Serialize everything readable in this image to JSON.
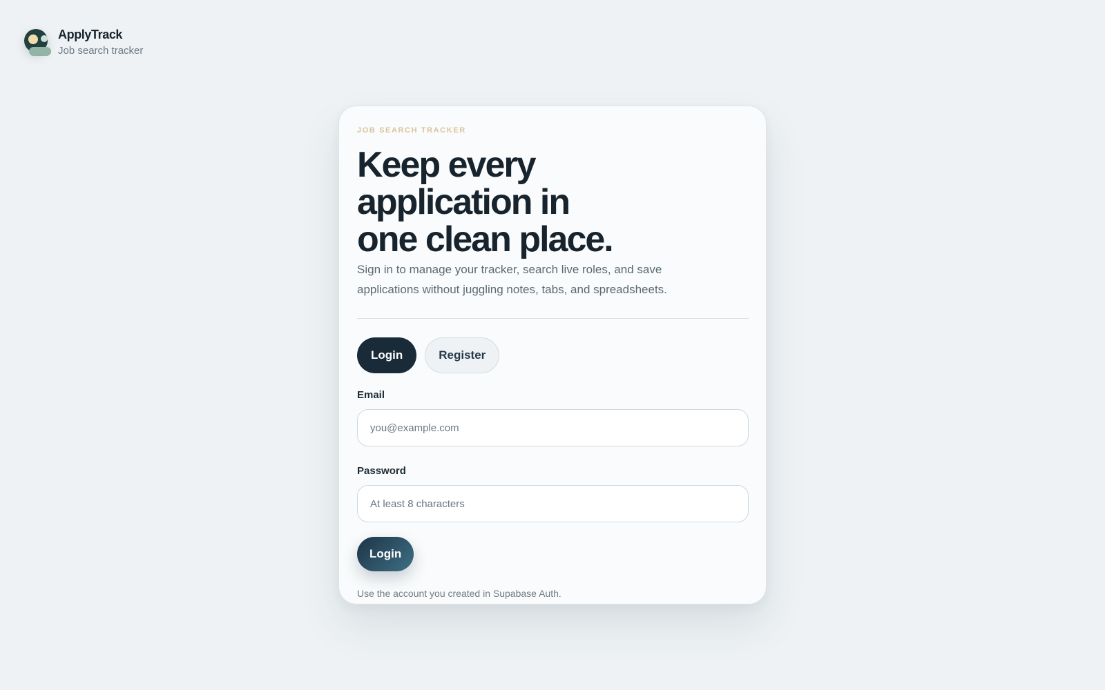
{
  "brand": {
    "name": "ApplyTrack",
    "tagline": "Job search tracker",
    "logo_icon": "avatar-logo-icon"
  },
  "card": {
    "eyebrow": "JOB SEARCH TRACKER",
    "headline": "Keep every application in one clean place.",
    "lede": "Sign in to manage your tracker, search live roles, and save applications without juggling notes, tabs, and spreadsheets.",
    "tabs": [
      {
        "label": "Login",
        "active": true
      },
      {
        "label": "Register",
        "active": false
      }
    ],
    "email": {
      "label": "Email",
      "placeholder": "you@example.com",
      "value": ""
    },
    "password": {
      "label": "Password",
      "placeholder": "At least 8 characters",
      "value": ""
    },
    "submit_label": "Login",
    "note": "Use the account you created in Supabase Auth."
  },
  "colors": {
    "background": "#eef2f4",
    "primary_dark": "#192b39",
    "accent_gold": "#d9c49b",
    "button_gradient_end": "#3e6f85"
  }
}
